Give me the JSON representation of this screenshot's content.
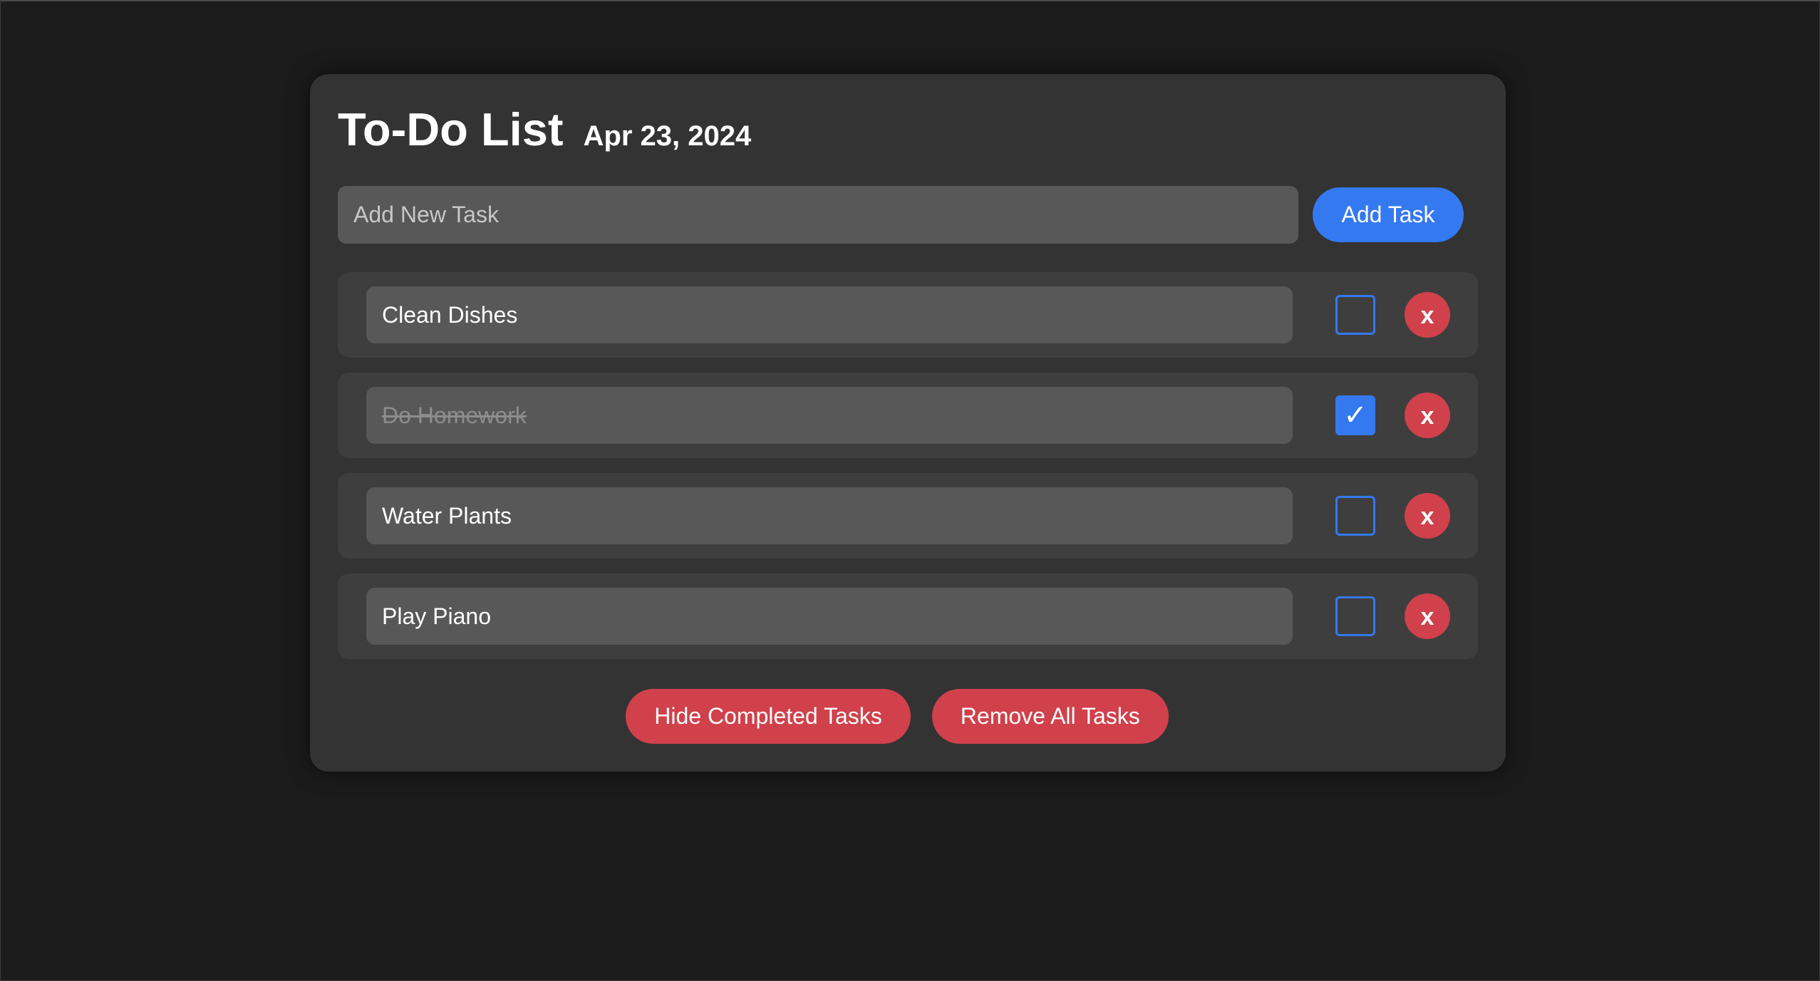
{
  "header": {
    "title": "To-Do List",
    "date": "Apr 23, 2024"
  },
  "new_task": {
    "placeholder": "Add New Task",
    "value": "",
    "add_label": "Add Task"
  },
  "tasks": [
    {
      "label": "Clean Dishes",
      "completed": false
    },
    {
      "label": "Do Homework",
      "completed": true
    },
    {
      "label": "Water Plants",
      "completed": false
    },
    {
      "label": "Play Piano",
      "completed": false
    }
  ],
  "icons": {
    "check": "✓",
    "delete": "x"
  },
  "footer": {
    "hide_completed_label": "Hide Completed Tasks",
    "remove_all_label": "Remove All Tasks"
  },
  "colors": {
    "background": "#1b1b1b",
    "card": "#333333",
    "accent_blue": "#3479ef",
    "danger_red": "#d0414b"
  }
}
